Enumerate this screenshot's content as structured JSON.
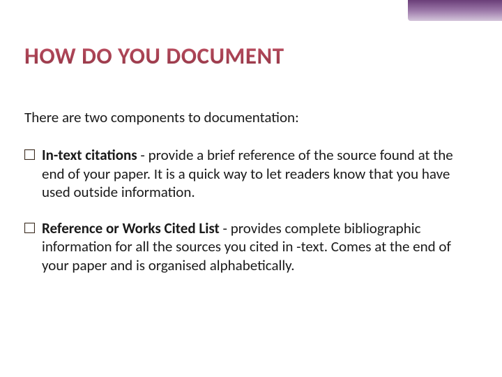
{
  "title": "HOW DO YOU DOCUMENT",
  "intro": "There are two components to documentation:",
  "items": [
    {
      "term": "In-text citations",
      "sep": " - ",
      "desc": "provide a brief reference of the source  found at the end of your paper.  It is a quick way to let readers know that you have used outside information."
    },
    {
      "term": "Reference or Works Cited List",
      "sep": " - ",
      "desc": "provides complete bibliographic information for all  the sources you cited in -text. Comes at the end of your paper and is organised alphabetically."
    }
  ]
}
